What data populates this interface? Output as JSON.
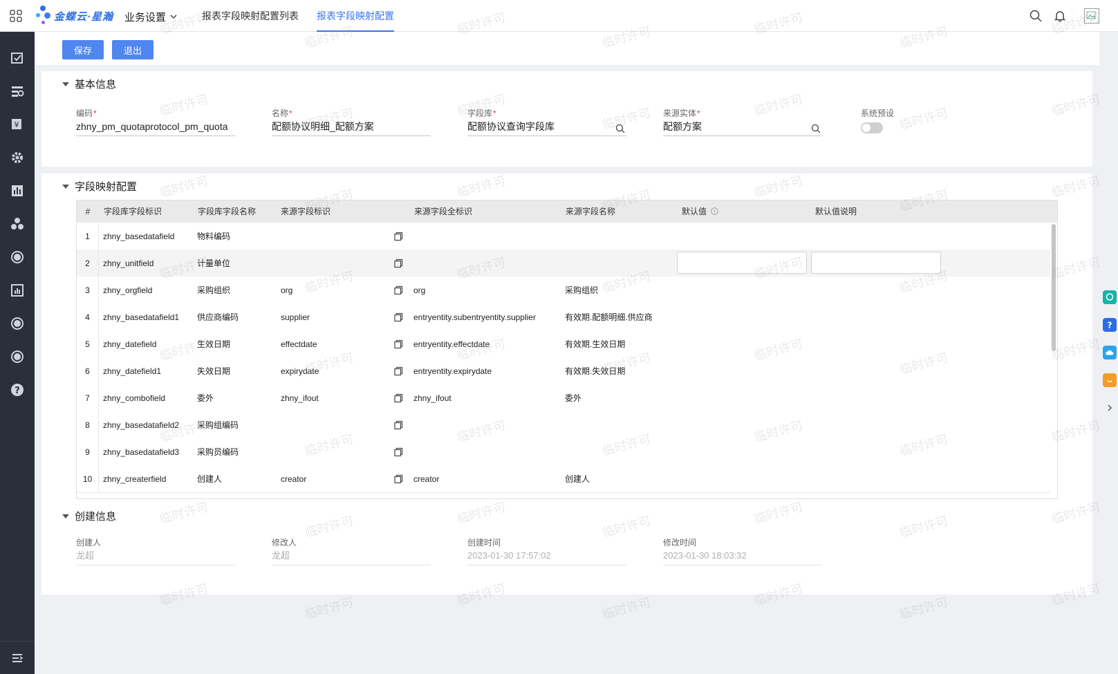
{
  "header": {
    "logo_text": "金蝶云·星瀚",
    "menu_label": "业务设置",
    "tabs": [
      {
        "label": "报表字段映射配置列表",
        "active": false
      },
      {
        "label": "报表字段映射配置",
        "active": true
      }
    ]
  },
  "toolbar": {
    "save_label": "保存",
    "exit_label": "退出"
  },
  "basic_info": {
    "title": "基本信息",
    "fields": {
      "code": {
        "label": "编码",
        "value": "zhny_pm_quotaprotocol_pm_quota"
      },
      "name": {
        "label": "名称",
        "value": "配额协议明细_配额方案"
      },
      "library": {
        "label": "字段库",
        "value": "配额协议查询字段库"
      },
      "source_entity": {
        "label": "来源实体",
        "value": "配额方案"
      },
      "preset": {
        "label": "系统预设",
        "value": false
      }
    }
  },
  "mapping": {
    "title": "字段映射配置",
    "columns": [
      "#",
      "字段库字段标识",
      "字段库字段名称",
      "来源字段标识",
      "来源字段全标识",
      "来源字段名称",
      "默认值",
      "默认值说明"
    ],
    "rows": [
      {
        "no": "1",
        "key": "zhny_basedatafield",
        "name": "物料编码",
        "src_key": "",
        "src_full": "",
        "src_name": ""
      },
      {
        "no": "2",
        "key": "zhny_unitfield",
        "name": "计量单位",
        "src_key": "",
        "src_full": "",
        "src_name": ""
      },
      {
        "no": "3",
        "key": "zhny_orgfield",
        "name": "采购组织",
        "src_key": "org",
        "src_full": "org",
        "src_name": "采购组织"
      },
      {
        "no": "4",
        "key": "zhny_basedatafield1",
        "name": "供应商编码",
        "src_key": "supplier",
        "src_full": "entryentity.subentryentity.supplier",
        "src_name": "有效期.配额明细.供应商"
      },
      {
        "no": "5",
        "key": "zhny_datefield",
        "name": "生效日期",
        "src_key": "effectdate",
        "src_full": "entryentity.effectdate",
        "src_name": "有效期.生效日期"
      },
      {
        "no": "6",
        "key": "zhny_datefield1",
        "name": "失效日期",
        "src_key": "expirydate",
        "src_full": "entryentity.expirydate",
        "src_name": "有效期.失效日期"
      },
      {
        "no": "7",
        "key": "zhny_combofield",
        "name": "委外",
        "src_key": "zhny_ifout",
        "src_full": "zhny_ifout",
        "src_name": "委外"
      },
      {
        "no": "8",
        "key": "zhny_basedatafield2",
        "name": "采购组编码",
        "src_key": "",
        "src_full": "",
        "src_name": ""
      },
      {
        "no": "9",
        "key": "zhny_basedatafield3",
        "name": "采购员编码",
        "src_key": "",
        "src_full": "",
        "src_name": ""
      },
      {
        "no": "10",
        "key": "zhny_createrfield",
        "name": "创建人",
        "src_key": "creator",
        "src_full": "creator",
        "src_name": "创建人"
      }
    ]
  },
  "create_info": {
    "title": "创建信息",
    "fields": {
      "creator": {
        "label": "创建人",
        "value": "龙超"
      },
      "modifier": {
        "label": "修改人",
        "value": "龙超"
      },
      "created_at": {
        "label": "创建时间",
        "value": "2023-01-30 17:57:02"
      },
      "modified_at": {
        "label": "修改时间",
        "value": "2023-01-30 18:03:32"
      }
    }
  },
  "watermark": "临时许可",
  "colors": {
    "accent": "#3a74f1",
    "button": "#4f86ef",
    "sidebar": "#2b2f3a",
    "required": "#e53935"
  }
}
